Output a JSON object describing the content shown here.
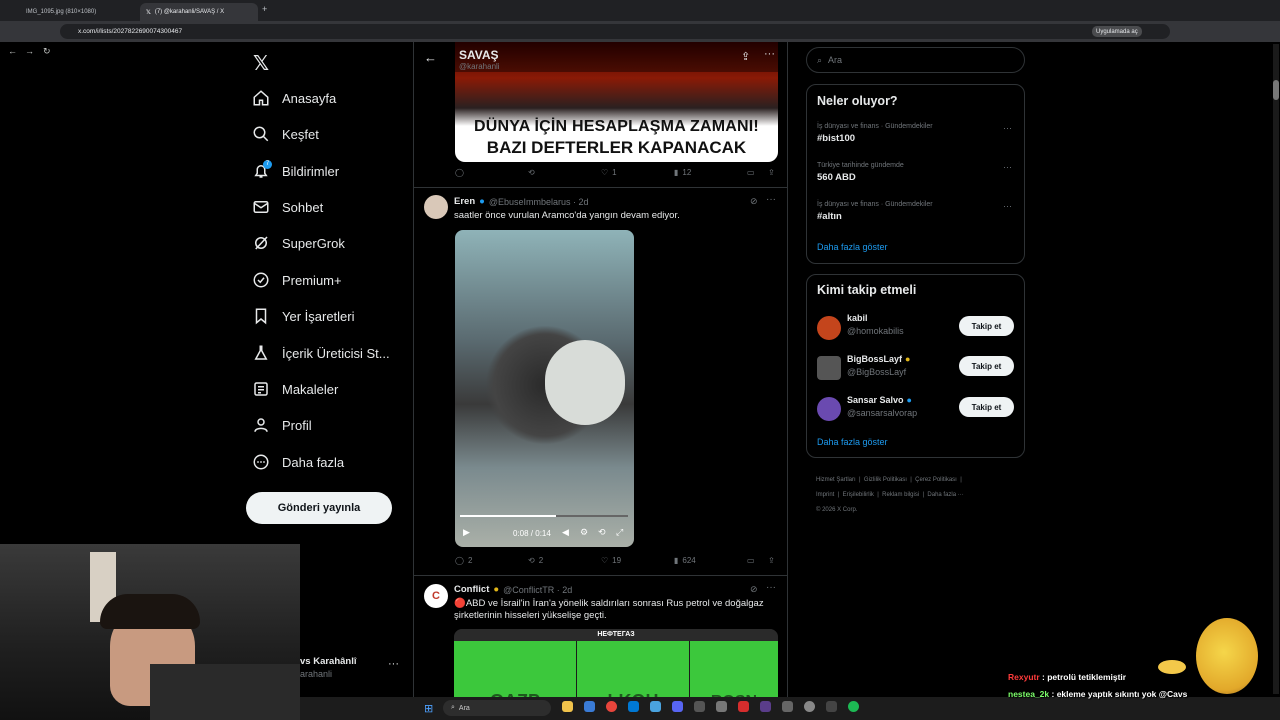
{
  "browser": {
    "tabs": [
      {
        "label": "IMG_1095.jpg (810×1080)"
      },
      {
        "label": "(7) @karahanli/SAVAŞ / X"
      }
    ],
    "url": "x.com/i/lists/2027822690074300467",
    "app_button": "Uygulamada aç"
  },
  "nav": {
    "items": [
      {
        "label": "Anasayfa",
        "icon": "home-icon"
      },
      {
        "label": "Keşfet",
        "icon": "search-icon"
      },
      {
        "label": "Bildirimler",
        "icon": "bell-icon",
        "badge": "7"
      },
      {
        "label": "Sohbet",
        "icon": "mail-icon"
      },
      {
        "label": "SuperGrok",
        "icon": "grok-icon"
      },
      {
        "label": "Premium+",
        "icon": "verified-icon"
      },
      {
        "label": "Yer İşaretleri",
        "icon": "bookmark-icon"
      },
      {
        "label": "İçerik Üreticisi St...",
        "icon": "flask-icon"
      },
      {
        "label": "Makaleler",
        "icon": "article-icon"
      },
      {
        "label": "Profil",
        "icon": "person-icon"
      },
      {
        "label": "Daha fazla",
        "icon": "more-circle-icon"
      }
    ],
    "post_button": "Gönderi yayınla",
    "account_name": "vs Karahânlî",
    "account_handle": "arahanli"
  },
  "list_header": {
    "title": "SAVAŞ",
    "handle": "@karahanli"
  },
  "tweets": [
    {
      "banner_line1": "DÜNYA İÇİN HESAPLAŞMA ZAMANI!",
      "banner_line2": "BAZI DEFTERLER KAPANACAK",
      "replies": "",
      "retweets": "",
      "likes": "1",
      "views": "12"
    },
    {
      "name": "Eren",
      "handle": "@EbuseImmbelarus · 2d",
      "text": "saatler önce vurulan Aramco'da yangın devam ediyor.",
      "video_time": "0:08 / 0:14",
      "video_progress": 0.57,
      "replies": "2",
      "retweets": "2",
      "likes": "19",
      "views": "624"
    },
    {
      "name": "Conflict",
      "handle": "@ConflictTR · 2d",
      "text": "🔴ABD ve İsrail'in İran'a yönelik saldırıları sonrası Rus petrol ve doğalgaz şirketlerinin hisseleri yükselişe geçti.",
      "media_header": "НЕФТЕГАЗ",
      "media_tiles": [
        "GAZP",
        "LKOH",
        "ROSN"
      ]
    }
  ],
  "right": {
    "search_placeholder": "Ara",
    "trends_title": "Neler oluyor?",
    "trends": [
      {
        "meta": "İş dünyası ve finans · Gündemdekiler",
        "name": "#bist100"
      },
      {
        "meta": "Türkiye tarihinde gündemde",
        "name": "560 ABD"
      },
      {
        "meta": "İş dünyası ve finans · Gündemdekiler",
        "name": "#altın"
      }
    ],
    "show_more": "Daha fazla göster",
    "follow_title": "Kimi takip etmeli",
    "follow": [
      {
        "name": "kabil",
        "handle": "@homokabilis",
        "verified": false
      },
      {
        "name": "BigBossLayf",
        "handle": "@BigBossLayf",
        "verified": true
      },
      {
        "name": "Sansar Salvo",
        "handle": "@sansarsalvorap",
        "verified": true
      }
    ],
    "follow_button": "Takip et",
    "show_more2": "Daha fazla göster",
    "footer": [
      "Hizmet Şartları",
      "Gizlilik Politikası",
      "Çerez Politikası",
      "Imprint",
      "Erişilebilirlik",
      "Reklam bilgisi",
      "Daha fazla ···",
      "© 2026 X Corp."
    ]
  },
  "taskbar": {
    "search": "Ara"
  },
  "chat": [
    {
      "user": "Rexyutr",
      "msg": "petrolü tetiklemiştir",
      "color": "#ff3b3b"
    },
    {
      "user": "nestea_2k",
      "msg": "ekleme yaptık sıkıntı yok @Cavs",
      "color": "#7dff6b"
    }
  ]
}
